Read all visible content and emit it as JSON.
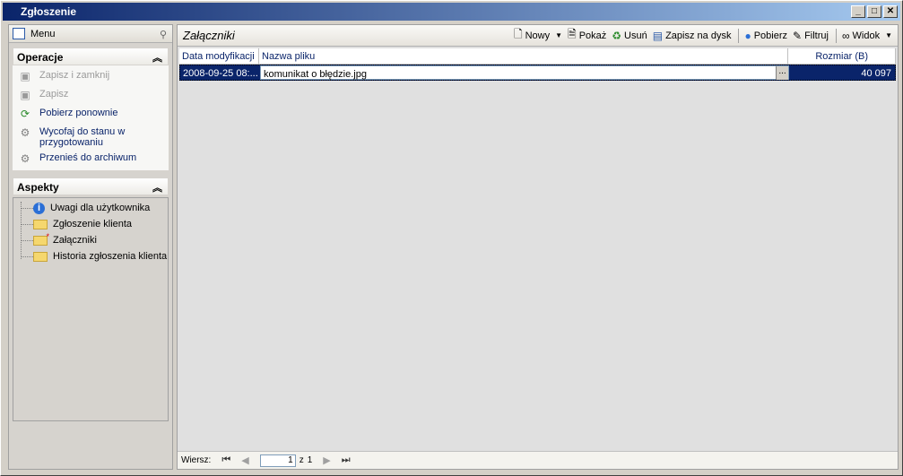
{
  "window": {
    "title": "Zgłoszenie",
    "buttons": [
      "_",
      "□",
      "✕"
    ]
  },
  "left": {
    "menu_title": "Menu",
    "operations": {
      "title": "Operacje",
      "items": [
        {
          "label": "Zapisz i zamknij",
          "icon": "save-close-icon",
          "enabled": false
        },
        {
          "label": "Zapisz",
          "icon": "save-icon",
          "enabled": false
        },
        {
          "label": "Pobierz ponownie",
          "icon": "refresh-icon",
          "enabled": true
        },
        {
          "label": "Wycofaj do stanu w przygotowaniu",
          "icon": "gear-icon",
          "enabled": true
        },
        {
          "label": "Przenieś do archiwum",
          "icon": "gear-icon",
          "enabled": true
        }
      ]
    },
    "aspects": {
      "title": "Aspekty",
      "items": [
        {
          "label": "Uwagi dla użytkownika",
          "icon": "info-icon"
        },
        {
          "label": "Zgłoszenie klienta",
          "icon": "folder-icon"
        },
        {
          "label": "Załączniki",
          "icon": "folder-open-icon"
        },
        {
          "label": "Historia zgłoszenia klienta",
          "icon": "folder-icon"
        }
      ]
    }
  },
  "main": {
    "header": "Załączniki",
    "toolbar": {
      "new": "Nowy",
      "show": "Pokaż",
      "delete": "Usuń",
      "save_disk": "Zapisz na dysk",
      "download": "Pobierz",
      "filter": "Filtruj",
      "view": "Widok"
    },
    "columns": [
      "Data modyfikacji",
      "Nazwa pliku",
      "Rozmiar (B)"
    ],
    "rows": [
      {
        "date": "2008-09-25  08:...",
        "name": "komunikat o błędzie.jpg",
        "size": "40 097"
      }
    ],
    "pager": {
      "label": "Wiersz:",
      "current": "1",
      "of": "z",
      "total": "1"
    }
  }
}
